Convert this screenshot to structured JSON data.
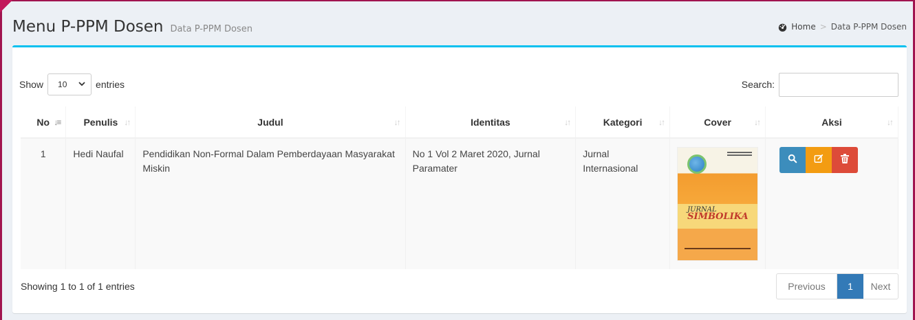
{
  "header": {
    "title": "Menu P-PPM Dosen",
    "subtitle": "Data P-PPM Dosen",
    "breadcrumb": {
      "home": "Home",
      "separator": ">",
      "current": "Data P-PPM Dosen"
    }
  },
  "controls": {
    "show_label": "Show",
    "entries_label": "entries",
    "page_length": "10",
    "search_label": "Search:",
    "search_value": ""
  },
  "table": {
    "columns": [
      "No",
      "Penulis",
      "Judul",
      "Identitas",
      "Kategori",
      "Cover",
      "Aksi"
    ],
    "rows": [
      {
        "no": "1",
        "penulis": "Hedi Naufal",
        "judul": "Pendidikan Non-Formal Dalam Pemberdayaan Masyarakat Miskin",
        "identitas": "No 1 Vol 2 Maret 2020, Jurnal Paramater",
        "kategori": "Jurnal Internasional",
        "cover": {
          "journal": "JURNAL",
          "name": "SIMBOLIKA"
        }
      }
    ]
  },
  "footer": {
    "info": "Showing 1 to 1 of 1 entries",
    "previous": "Previous",
    "current_page": "1",
    "next": "Next"
  },
  "colors": {
    "accent": "#00c0ef",
    "frame": "#a0144f",
    "view_button": "#3c8dbc",
    "edit_button": "#f39c12",
    "delete_button": "#dd4b39",
    "active_page": "#337ab7"
  },
  "icons": {
    "home": "dashboard-icon",
    "view": "search-icon",
    "edit": "edit-icon",
    "delete": "trash-icon",
    "dropdown": "chevron-down-icon",
    "sort": "sort-icon"
  }
}
